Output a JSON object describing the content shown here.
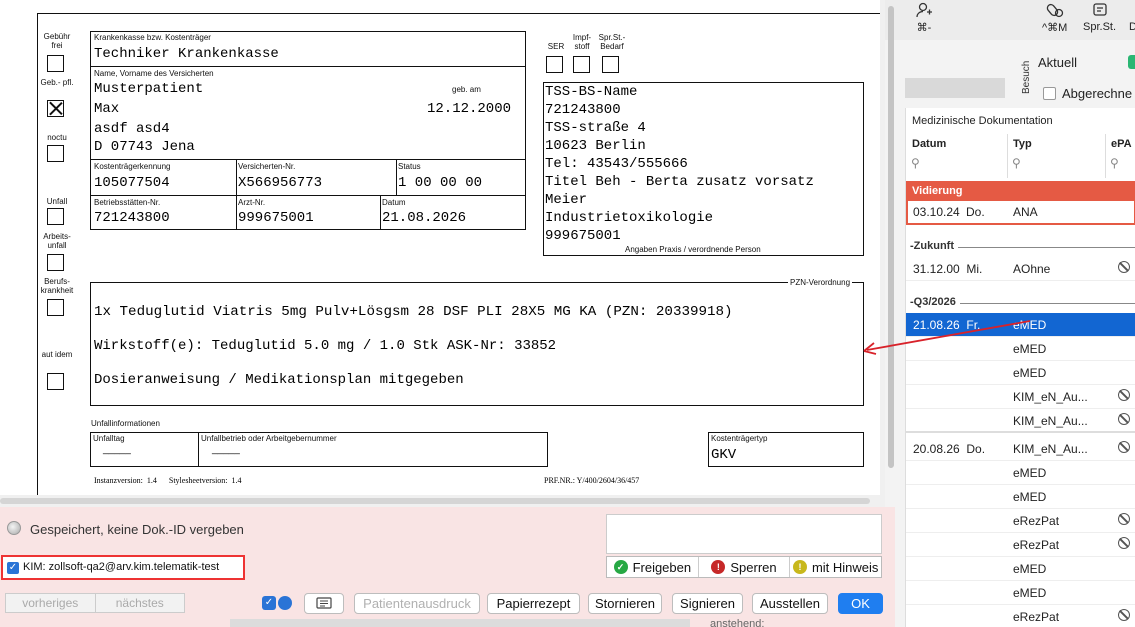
{
  "toolbar": {
    "btn1_shortcut": "⌘-",
    "btn2_shortcut": "^⌘M",
    "btn3_label": "Spr.St.",
    "btn4_label": "Do"
  },
  "besuch": {
    "label": "Besuch",
    "aktuell": "Aktuell",
    "abgerechnet": "Abgerechne"
  },
  "meddoc": {
    "title": "Medizinische Dokumentation",
    "columns": [
      "Datum",
      "Typ",
      "ePA"
    ],
    "vidierung": {
      "label": "Vidierung",
      "date": "03.10.24",
      "day": "Do.",
      "type": "ANA"
    },
    "groups": [
      {
        "label": "Zukunft"
      },
      {
        "label": "Q3/2026"
      }
    ],
    "rows": [
      {
        "date": "31.12.00",
        "day": "Mi.",
        "type": "AOhne",
        "blocked": true
      },
      {
        "date": "21.08.26",
        "day": "Fr.",
        "type": "eMED",
        "blocked": false
      },
      {
        "date": "",
        "day": "",
        "type": "eMED",
        "blocked": false
      },
      {
        "date": "",
        "day": "",
        "type": "eMED",
        "blocked": false
      },
      {
        "date": "",
        "day": "",
        "type": "KIM_eN_Au...",
        "blocked": true
      },
      {
        "date": "",
        "day": "",
        "type": "KIM_eN_Au...",
        "blocked": true
      },
      {
        "date": "20.08.26",
        "day": "Do.",
        "type": "KIM_eN_Au...",
        "blocked": true
      },
      {
        "date": "",
        "day": "",
        "type": "eMED",
        "blocked": false
      },
      {
        "date": "",
        "day": "",
        "type": "eMED",
        "blocked": false
      },
      {
        "date": "",
        "day": "",
        "type": "eRezPat",
        "blocked": true
      },
      {
        "date": "",
        "day": "",
        "type": "eRezPat",
        "blocked": true
      },
      {
        "date": "",
        "day": "",
        "type": "eMED",
        "blocked": false
      },
      {
        "date": "",
        "day": "",
        "type": "eMED",
        "blocked": false
      },
      {
        "date": "",
        "day": "",
        "type": "eRezPat",
        "blocked": true
      }
    ]
  },
  "form": {
    "left_labels": {
      "gebuehr": "Gebühr frei",
      "gebpfl": "Geb.- pfl.",
      "noctu": "noctu",
      "unfall": "Unfall",
      "arbeitsunfall": "Arbeits- unfall",
      "berufskrankheit": "Berufs- krankheit",
      "autidem": "aut idem"
    },
    "kasse_label": "Krankenkasse bzw. Kostenträger",
    "kasse": "Techniker Krankenkasse",
    "name_label": "Name, Vorname des Versicherten",
    "gebam_label": "geb. am",
    "surname": "Musterpatient",
    "firstname": "Max",
    "birthdate": "12.12.2000",
    "street": "asdf asd4",
    "city": "D 07743 Jena",
    "kk_label": "Kostenträgerkennung",
    "kk": "105077504",
    "vnr_label": "Versicherten-Nr.",
    "vnr": "X566956773",
    "status_label": "Status",
    "status": "1 00 00 00",
    "bsnr_label": "Betriebsstätten-Nr.",
    "bsnr": "721243800",
    "lanr_label": "Arzt-Nr.",
    "lanr": "999675001",
    "datum_label": "Datum",
    "datum": "21.08.2026",
    "ser_label": "SER",
    "impf_label": "Impf- stoff",
    "sprst_label": "Spr.St.- Bedarf",
    "praxis_lines": [
      "TSS-BS-Name",
      "721243800",
      "TSS-straße 4",
      "10623 Berlin",
      "Tel: 43543/555666",
      "Titel Beh - Berta zusatz vorsatz",
      "Meier",
      "Industrietoxikologie",
      "999675001"
    ],
    "praxis_label": "Angaben Praxis / verordnende Person",
    "pzn_label": "PZN-Verordnung",
    "rx_lines": [
      "1x Teduglutid Viatris 5mg Pulv+Lösgsm 28 DSF PLI 28X5 MG KA (PZN: 20339918)",
      "Wirkstoff(e): Teduglutid 5.0 mg / 1.0 Stk ASK-Nr: 33852",
      "Dosieranweisung / Medikationsplan mitgegeben"
    ],
    "unfall_info_label": "Unfallinformationen",
    "unfalltag_label": "Unfalltag",
    "unfalltag": "_____",
    "unfallbetrieb_label": "Unfallbetrieb oder Arbeitgebernummer",
    "unfallbetrieb": "_____",
    "kt_label": "Kostenträgertyp",
    "kt": "GKV",
    "version_text": "Instanzversion:  1.4      Stylesheetversion:  1.4",
    "prf_text": "PRF.NR.:  Y/400/2604/36/457"
  },
  "bottom": {
    "saved_text": "Gespeichert, keine Dok.-ID vergeben",
    "kim_text": "KIM: zollsoft-qa2@arv.kim.telematik-test",
    "freigeben": "Freigeben",
    "sperren": "Sperren",
    "hinweis": "mit Hinweis",
    "vorheriges": "vorheriges",
    "naechstes": "nächstes",
    "patientenausdruck": "Patientenausdruck",
    "papierrezept": "Papierrezept",
    "stornieren": "Stornieren",
    "signieren": "Signieren",
    "ausstellen": "Ausstellen",
    "ok": "OK",
    "back_right": "anstehend:"
  },
  "colors": {
    "accent": "#1f7ef0",
    "vidierung": "#e55a44",
    "selected_row": "#1266d2",
    "kim_border": "#e33333"
  }
}
